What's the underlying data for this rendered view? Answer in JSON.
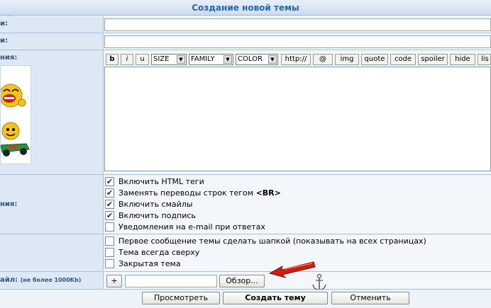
{
  "header": {
    "title": "Создание новой темы"
  },
  "labels": {
    "row1": "и:",
    "row2": "и:",
    "message": "ния:",
    "options": "ния:",
    "file": "айл:",
    "file_hint": "(не более 1000Kb)"
  },
  "toolbar": {
    "bold": "b",
    "italic": "i",
    "underline": "u",
    "size": "SIZE",
    "family": "FAMILY",
    "color": "COLOR",
    "url": "http://",
    "email": "@",
    "img": "img",
    "quote": "quote",
    "code": "code",
    "spoiler": "spoiler",
    "hide": "hide",
    "list": "lis"
  },
  "options": [
    {
      "label": "Включить HTML теги",
      "checked": true
    },
    {
      "label": "Заменять переводы строк тегом",
      "bold_suffix": "<BR>",
      "checked": true
    },
    {
      "label": "Включить смайлы",
      "checked": true
    },
    {
      "label": "Включить подпись",
      "checked": true
    },
    {
      "label": "Уведомления на e-mail при ответах",
      "checked": false
    }
  ],
  "topic_options": [
    {
      "label": "Первое сообщение темы сделать шапкой (показывать на всех страницах)",
      "checked": false
    },
    {
      "label": "Тема всегда сверху",
      "checked": false
    },
    {
      "label": "Закрытая тема",
      "checked": false
    }
  ],
  "file": {
    "add": "+",
    "browse": "Обзор..."
  },
  "actions": {
    "preview": "Просмотреть",
    "submit": "Создать тему",
    "cancel": "Отменить"
  },
  "colors": {
    "title": "#2a64b6",
    "label": "#33557e",
    "arrow": "#cc1f12"
  },
  "icons": [
    "laughing-smiley-icon",
    "racing-smiley-icon",
    "red-arrow-icon",
    "anchor-icon",
    "checkmark-icon"
  ]
}
